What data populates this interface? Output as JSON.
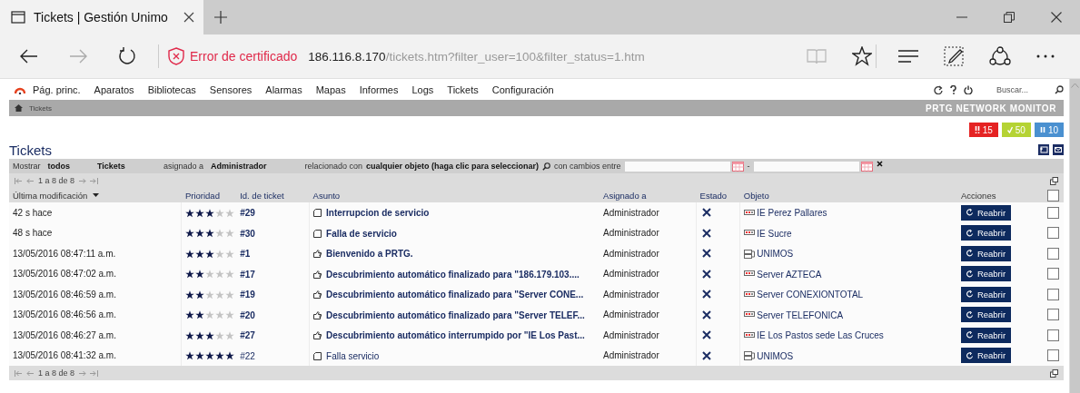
{
  "browser": {
    "tab": {
      "title": "Tickets | Gestión Unimo",
      "selected": true
    },
    "address": {
      "warning": "Error de certificado",
      "host": "186.116.8.170",
      "path": "/tickets.htm?filter_user=100&filter_status=1.htm"
    }
  },
  "nav": {
    "items": [
      "Pág. princ.",
      "Aparatos",
      "Bibliotecas",
      "Sensores",
      "Alarmas",
      "Mapas",
      "Informes",
      "Logs",
      "Tickets",
      "Configuración"
    ],
    "search": {
      "placeholder": "Buscar..."
    }
  },
  "breadcrumb": {
    "items": [
      "Tickets"
    ],
    "brand": "PRTG NETWORK MONITOR"
  },
  "status_badges": [
    {
      "kind": "alarm",
      "count": "15",
      "color": "#e52222"
    },
    {
      "kind": "ok",
      "count": "50",
      "color": "#b5d334"
    },
    {
      "kind": "paused",
      "count": "10",
      "color": "#4a90d0"
    }
  ],
  "page_title": "Tickets",
  "filter": {
    "show_label": "Mostrar",
    "status": "todos",
    "type": "Tickets",
    "assigned_label": "asignado a",
    "assigned": "Administrador",
    "related_label": "relacionado con",
    "object": "cualquier objeto (haga clic para seleccionar)",
    "changes_label": "con cambios entre",
    "range_separator": "-"
  },
  "pager_top": "1 a 8 de 8",
  "table": {
    "columns": [
      {
        "label": "Última modificación",
        "sortable": true,
        "sorted": true
      },
      {
        "label": "Prioridad",
        "sortable": true,
        "sorted": false
      },
      {
        "label": "Id. de ticket",
        "sortable": true,
        "sorted": false
      },
      {
        "label": "Asunto",
        "sortable": true,
        "sorted": false
      },
      {
        "label": "Asignado a",
        "sortable": true,
        "sorted": false
      },
      {
        "label": "Estado",
        "sortable": true,
        "sorted": false
      },
      {
        "label": "Objeto",
        "sortable": true,
        "sorted": false
      },
      {
        "label": "Acciones",
        "sortable": false
      }
    ],
    "select_all": {
      "checked": false
    },
    "rows": [
      {
        "modified": "42 s hace",
        "stars": 3,
        "id": "#29",
        "subject": {
          "kind": "note",
          "text": "Interrupcion de servicio"
        },
        "unread": true,
        "assigned": "Administrador",
        "closed": true,
        "object": {
          "kind": "device",
          "text": "IE Perez Pallares"
        },
        "action": "Reabrir",
        "checked": false
      },
      {
        "modified": "48 s hace",
        "stars": 3,
        "id": "#30",
        "subject": {
          "kind": "note",
          "text": "Falla de servicio"
        },
        "unread": true,
        "assigned": "Administrador",
        "closed": true,
        "object": {
          "kind": "device",
          "text": "IE Sucre"
        },
        "action": "Reabrir",
        "checked": false
      },
      {
        "modified": "13/05/2016 08:47:11 a.m.",
        "stars": 3,
        "id": "#1",
        "subject": {
          "kind": "notice",
          "text": "Bienvenido a PRTG."
        },
        "unread": true,
        "assigned": "Administrador",
        "closed": true,
        "object": {
          "kind": "probe",
          "text": "UNIMOS"
        },
        "action": "Reabrir",
        "checked": false
      },
      {
        "modified": "13/05/2016 08:47:02 a.m.",
        "stars": 2,
        "id": "#17",
        "subject": {
          "kind": "notice",
          "text": "Descubrimiento automático finalizado para \"186.179.103...."
        },
        "unread": true,
        "assigned": "Administrador",
        "closed": true,
        "object": {
          "kind": "device",
          "text": "Server AZTECA"
        },
        "action": "Reabrir",
        "checked": false
      },
      {
        "modified": "13/05/2016 08:46:59 a.m.",
        "stars": 2,
        "id": "#19",
        "subject": {
          "kind": "notice",
          "text": "Descubrimiento automático finalizado para \"Server CONE..."
        },
        "unread": true,
        "assigned": "Administrador",
        "closed": true,
        "object": {
          "kind": "device",
          "text": "Server CONEXIONTOTAL"
        },
        "action": "Reabrir",
        "checked": false
      },
      {
        "modified": "13/05/2016 08:46:56 a.m.",
        "stars": 2,
        "id": "#20",
        "subject": {
          "kind": "notice",
          "text": "Descubrimiento automático finalizado para \"Server TELEF..."
        },
        "unread": true,
        "assigned": "Administrador",
        "closed": true,
        "object": {
          "kind": "device",
          "text": "Server TELEFONICA"
        },
        "action": "Reabrir",
        "checked": false
      },
      {
        "modified": "13/05/2016 08:46:27 a.m.",
        "stars": 3,
        "id": "#27",
        "subject": {
          "kind": "notice",
          "text": "Descubrimiento automático interrumpido por \"IE Los Past..."
        },
        "unread": true,
        "assigned": "Administrador",
        "closed": true,
        "object": {
          "kind": "device",
          "text": "IE Los Pastos sede Las Cruces"
        },
        "action": "Reabrir",
        "checked": false
      },
      {
        "modified": "13/05/2016 08:41:32 a.m.",
        "stars": 5,
        "id": "#22",
        "subject": {
          "kind": "note",
          "text": "Falla servicio"
        },
        "unread": false,
        "assigned": "Administrador",
        "closed": true,
        "object": {
          "kind": "probe",
          "text": "UNIMOS"
        },
        "action": "Reabrir",
        "checked": false
      }
    ]
  },
  "pager_bottom": "1 a 8 de 8"
}
